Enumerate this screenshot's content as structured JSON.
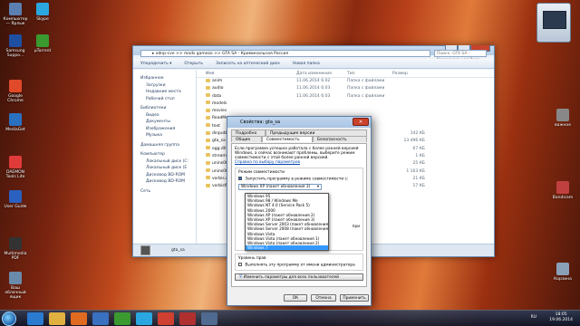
{
  "desktop": {
    "icons_left": [
      {
        "name": "computer-icon",
        "label": "Компьютер — Ярлык",
        "color": "#5a7fb0"
      },
      {
        "name": "skype-icon",
        "label": "Skype",
        "color": "#2aa7e0"
      },
      {
        "name": "samsung-support-icon",
        "label": "Samsung Suppo...",
        "color": "#1e4fa0"
      },
      {
        "name": "utorrent-icon",
        "label": "µTorrent",
        "color": "#3a9a30"
      },
      {
        "name": "chrome-icon",
        "label": "Google Chrome",
        "color": "#e04a2a"
      },
      {
        "name": "mediaget-icon",
        "label": "MediaGet",
        "color": "#2a70c0"
      },
      {
        "name": "daemon-tools-icon",
        "label": "DAEMON Tools Lite",
        "color": "#e03a3a"
      },
      {
        "name": "user-guide-icon",
        "label": "User Guide",
        "color": "#2a60c0"
      },
      {
        "name": "multimedia-pdf-icon",
        "label": "Multimedia PDF",
        "color": "#333333"
      },
      {
        "name": "recycle-bin-icon",
        "label": "Ваш облачный ящик",
        "color": "#6a8aaa"
      }
    ],
    "icons_right": [
      {
        "name": "important-icon",
        "label": "важное",
        "color": "#888888"
      },
      {
        "name": "bandicam-icon",
        "label": "Bandicam",
        "color": "#c04040"
      },
      {
        "name": "recycle-icon",
        "label": "Корзина",
        "color": "#8aa0b8"
      }
    ]
  },
  "explorer": {
    "address": "▸ odnp-cve >> mods gamezo >> GTA SA - Криминальная Россия",
    "search_placeholder": "Поиск: GTA SA - Криминальная Росс...",
    "toolbar": [
      "Упорядочить ▾",
      "Открыть",
      "Записать на оптический диск",
      "Новая папка"
    ],
    "nav": {
      "favorites": "Избранное",
      "fav_items": [
        "Загрузки",
        "Недавние места",
        "Рабочий стол"
      ],
      "libraries": "Библиотеки",
      "lib_items": [
        "Видео",
        "Документы",
        "Изображения",
        "Музыка"
      ],
      "homegroup": "Домашняя группа",
      "computer": "Компьютер",
      "comp_items": [
        "Локальный диск (C:",
        "Локальный диск (E",
        "Дисковод BD-ROM",
        "Дисковод BD-ROM"
      ],
      "network": "Сеть"
    },
    "columns": [
      "Имя",
      "Дата изменения",
      "Тип",
      "Размер"
    ],
    "rows": [
      {
        "name": "anim",
        "date": "11.06.2014 6:02",
        "type": "Папка с файлами",
        "size": ""
      },
      {
        "name": "audio",
        "date": "11.06.2014 6:03",
        "type": "Папка с файлами",
        "size": ""
      },
      {
        "name": "data",
        "date": "11.06.2014 6:03",
        "type": "Папка с файлами",
        "size": ""
      },
      {
        "name": "models",
        "date": "",
        "type": "",
        "size": ""
      },
      {
        "name": "movies",
        "date": "",
        "type": "",
        "size": ""
      },
      {
        "name": "ReadMe",
        "date": "",
        "type": "",
        "size": ""
      },
      {
        "name": "text",
        "date": "",
        "type": "",
        "size": ""
      },
      {
        "name": "dinput8.dll",
        "date": "",
        "type": "",
        "size": "142 КБ"
      },
      {
        "name": "gta_sa",
        "date": "",
        "type": "",
        "size": "13 496 КБ"
      },
      {
        "name": "ogg.dll",
        "date": "",
        "type": "",
        "size": "67 КБ"
      },
      {
        "name": "stream.ini",
        "date": "",
        "type": "",
        "size": "1 КБ"
      },
      {
        "name": "unins000.dat",
        "date": "",
        "type": "",
        "size": "25 КБ"
      },
      {
        "name": "unins000",
        "date": "",
        "type": "",
        "size": "1 163 КБ"
      },
      {
        "name": "vorbis.dll",
        "date": "",
        "type": "",
        "size": "21 КБ"
      },
      {
        "name": "vorbisfile.dll",
        "date": "",
        "type": "",
        "size": "17 КБ"
      }
    ],
    "details": "gta_sa"
  },
  "dialog": {
    "title": "Свойства: gta_sa",
    "tabs_top": [
      "Подробно",
      "Предыдущие версии"
    ],
    "tabs_bottom": [
      "Общие",
      "Совместимость",
      "Безопасность"
    ],
    "intro": "Если программа успешно работала с более ранней версией Windows, а сейчас возникают проблемы, выберите режим совместимости с этой более ранней версией.",
    "help_link": "Справка по выбору параметров",
    "compat_group": "Режим совместимости",
    "compat_check": "Запустить программу в режиме совместимости с:",
    "selected": "Windows XP (пакет обновления 3)",
    "options": [
      "Windows 95",
      "Windows 98 / Windows Me",
      "Windows NT 4.0 (Service Pack 5)",
      "Windows 2000",
      "Windows XP (пакет обновления 2)",
      "Windows XP (пакет обновления 3)",
      "Windows Server 2003 (пакет обновления 1)",
      "Windows Server 2008 (пакет обновления 1)",
      "Windows Vista",
      "Windows Vista (пакет обновления 1)",
      "Windows Vista (пакет обновления 2)",
      "Windows 7"
    ],
    "hint_right": "при",
    "level_group": "Уровень прав",
    "admin_check": "Выполнять эту программу от имени администратора",
    "all_users": "Изменить параметры для всех пользователей",
    "ok": "ОК",
    "cancel": "Отмена",
    "apply": "Применить"
  },
  "tray": {
    "lang": "RU",
    "time": "18:05",
    "date": "19.06.2014"
  }
}
